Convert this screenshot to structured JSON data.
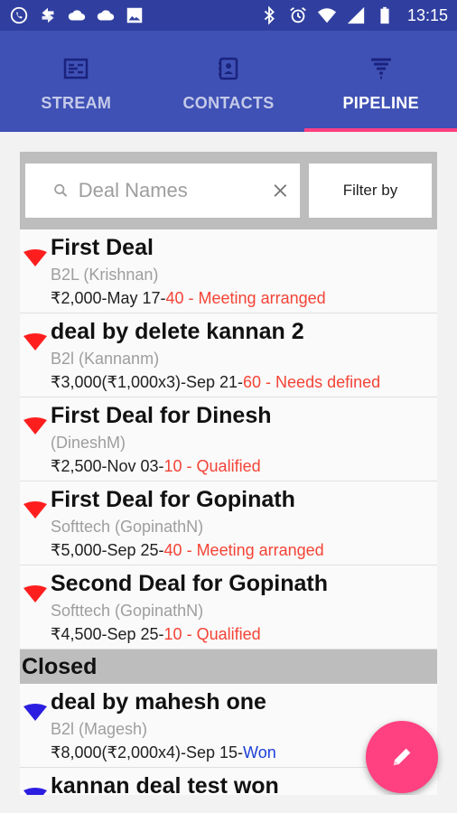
{
  "statusbar": {
    "time": "13:15",
    "left_icons": [
      "whatsapp-icon",
      "sync-icon",
      "cloud-icon",
      "cloud-icon",
      "image-icon"
    ],
    "right_icons": [
      "bluetooth-icon",
      "alarm-icon",
      "wifi-icon",
      "signal-icon",
      "battery-icon"
    ]
  },
  "tabs": [
    {
      "label": "STREAM",
      "icon": "stream-icon",
      "active": false
    },
    {
      "label": "CONTACTS",
      "icon": "contacts-icon",
      "active": false
    },
    {
      "label": "PIPELINE",
      "icon": "funnel-icon",
      "active": true
    }
  ],
  "search": {
    "placeholder": "Deal Names",
    "value": ""
  },
  "filter": {
    "label": "Filter by"
  },
  "open_deals": [
    {
      "title": "First Deal",
      "sub": "B2L  (Krishnan)",
      "amount": "₹2,000-May 17-",
      "stage": "40 - Meeting arranged"
    },
    {
      "title": "deal by delete kannan 2",
      "sub": "B2l  (Kannanm)",
      "amount": "₹3,000(₹1,000x3)-Sep 21-",
      "stage": "60 - Needs defined"
    },
    {
      "title": "First Deal for Dinesh",
      "sub": "  (DineshM)",
      "amount": "₹2,500-Nov 03-",
      "stage": "10 - Qualified"
    },
    {
      "title": "First Deal for Gopinath",
      "sub": "Softtech  (GopinathN)",
      "amount": "₹5,000-Sep 25-",
      "stage": "40 - Meeting arranged"
    },
    {
      "title": "Second Deal for Gopinath",
      "sub": "Softtech  (GopinathN)",
      "amount": "₹4,500-Sep 25-",
      "stage": "10 - Qualified"
    }
  ],
  "closed_section": {
    "label": "Closed"
  },
  "closed_deals": [
    {
      "title": "deal by mahesh one",
      "sub": "B2l  (Magesh)",
      "amount": "₹8,000(₹2,000x4)-Sep 15-",
      "stage": "Won"
    },
    {
      "title": "kannan deal test won",
      "sub": "",
      "amount": "",
      "stage": ""
    }
  ],
  "colors": {
    "status_bar": "#303f9f",
    "tab_bar": "#3f51b5",
    "accent": "#ff4081",
    "open_funnel": "#ff1e1e",
    "closed_funnel": "#2c1ee0",
    "stage_text": "#f44336",
    "won_text": "#1e40d8"
  },
  "fab": {
    "icon": "edit-pencil-icon"
  }
}
